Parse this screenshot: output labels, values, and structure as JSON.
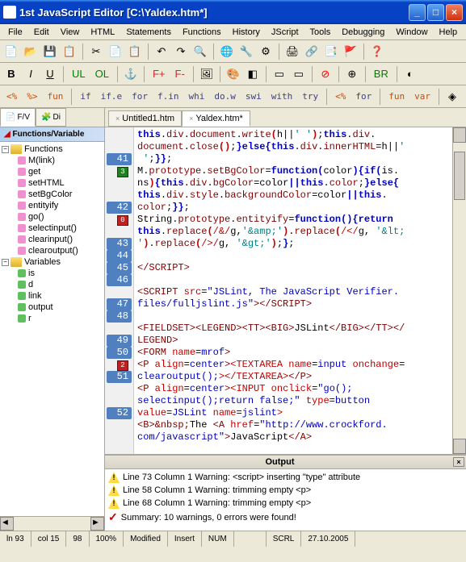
{
  "title": "1st JavaScript Editor      [C:\\Yaldex.htm*]",
  "menu": [
    "File",
    "Edit",
    "View",
    "HTML",
    "Statements",
    "Functions",
    "History",
    "JScript",
    "Tools",
    "Debugging",
    "Window",
    "Help"
  ],
  "toolbar2": {
    "b": "B",
    "i": "I",
    "u": "U",
    "ul": "UL",
    "ol": "OL",
    "fplus": "F+",
    "fminus": "F-",
    "br": "BR"
  },
  "toolbar3": [
    "<%",
    "%>",
    "fun",
    "if",
    "if.e",
    "for",
    "f.in",
    "whi",
    "do.w",
    "swi",
    "with",
    "try",
    "<%",
    "for",
    "fun",
    "var"
  ],
  "sidebar": {
    "tabs": [
      "F/V",
      "Di"
    ],
    "header": "Functions/Variable",
    "funcLabel": "Functions",
    "varLabel": "Variables",
    "functions": [
      "M(link)",
      "get",
      "setHTML",
      "setBgColor",
      "entityify",
      "go()",
      "selectinput()",
      "clearinput()",
      "clearoutput()"
    ],
    "variables": [
      "is",
      "d",
      "link",
      "output",
      "r"
    ]
  },
  "tabs": [
    {
      "label": "Untitled1.htm",
      "active": false
    },
    {
      "label": "Yaldex.htm*",
      "active": true
    }
  ],
  "gutter": [
    "",
    "",
    "41",
    "",
    "",
    "",
    "42",
    "",
    "",
    "43",
    "44",
    "45",
    "46",
    "",
    "47",
    "48",
    "",
    "49",
    "50",
    "",
    "51",
    "",
    "",
    "52",
    ""
  ],
  "output": {
    "title": "Output",
    "lines": [
      "Line 73 Column 1  Warning: <script> inserting \"type\" attribute",
      "Line 58 Column 1  Warning: trimming empty <p>",
      "Line 68 Column 1  Warning: trimming empty <p>"
    ],
    "summary": "Summary: 10 warnings, 0 errors were found!"
  },
  "status": {
    "ln": "ln 93",
    "col": "col 15",
    "ln2": "98",
    "total": "100%",
    "mod": "Modified",
    "ins": "Insert",
    "num": "NUM",
    "scrl": "SCRL",
    "date": "27.10.2005"
  }
}
